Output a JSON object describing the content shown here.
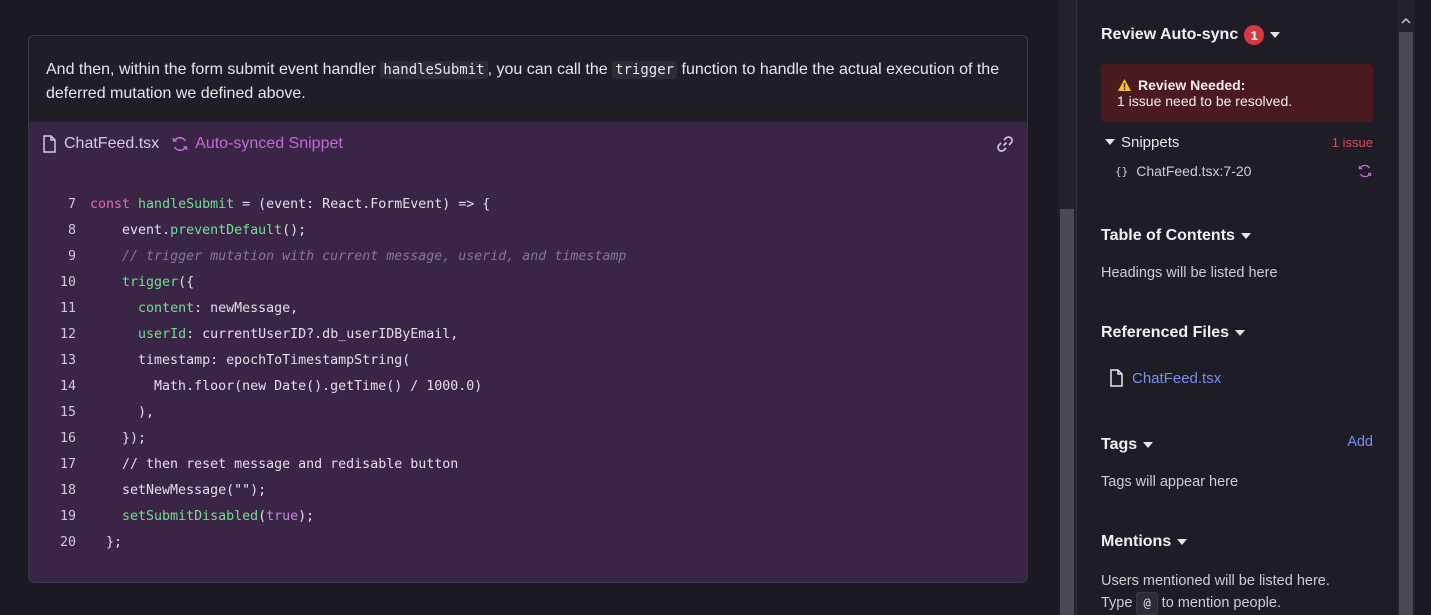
{
  "doc": {
    "text_before": "And then, within the form submit event handler ",
    "code1": "handleSubmit",
    "text_mid": ", you can call the ",
    "code2": "trigger",
    "text_after": " function to handle the actual execution of the deferred mutation we defined above."
  },
  "snippet": {
    "file_name": "ChatFeed.tsx",
    "sync_label": "Auto-synced Snippet",
    "lines": [
      {
        "n": "7"
      },
      {
        "n": "8"
      },
      {
        "n": "9"
      },
      {
        "n": "10"
      },
      {
        "n": "11"
      },
      {
        "n": "12"
      },
      {
        "n": "13"
      },
      {
        "n": "14"
      },
      {
        "n": "15"
      },
      {
        "n": "16"
      },
      {
        "n": "17"
      },
      {
        "n": "18"
      },
      {
        "n": "19"
      },
      {
        "n": "20"
      }
    ]
  },
  "sidebar": {
    "review": {
      "title": "Review Auto-sync",
      "badge": "1",
      "alert_title": "Review Needed:",
      "alert_body": "1 issue need to be resolved.",
      "snippets_label": "Snippets",
      "issue_count": "1 issue",
      "snippet_item": "ChatFeed.tsx:7-20"
    },
    "toc": {
      "title": "Table of Contents",
      "empty": "Headings will be listed here"
    },
    "refs": {
      "title": "Referenced Files",
      "file": "ChatFeed.tsx"
    },
    "tags": {
      "title": "Tags",
      "add": "Add",
      "empty": "Tags will appear here"
    },
    "mentions": {
      "title": "Mentions",
      "line1": "Users mentioned will be listed here.",
      "line2_before": "Type",
      "key": "@",
      "line2_after": "to mention people."
    }
  },
  "colors": {
    "accent_purple": "#c06ad8",
    "link_blue": "#7a8ff0",
    "danger": "#d7383f",
    "snippet_bg": "#3b2547"
  }
}
